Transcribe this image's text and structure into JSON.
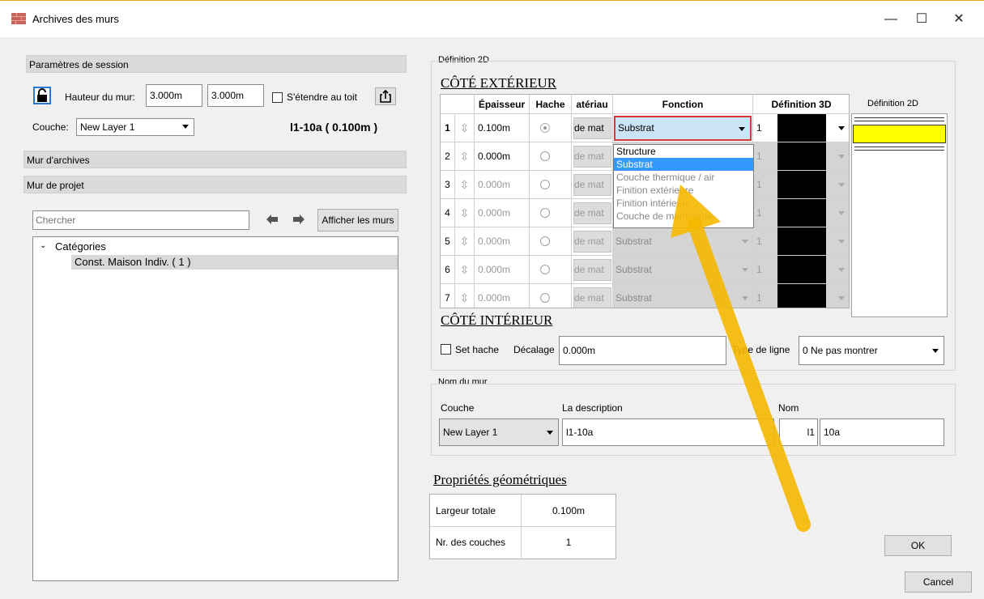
{
  "window": {
    "title": "Archives des murs",
    "minimize": "—",
    "maximize": "☐",
    "close": "✕"
  },
  "left": {
    "session_label": "Paramètres de session",
    "wall_height_label": "Hauteur du mur:",
    "wall_height_1": "3.000m",
    "wall_height_2": "3.000m",
    "extend_roof_label": "S'étendre au toit",
    "layer_label": "Couche:",
    "layer_value": "New Layer 1",
    "wall_code": "l1-10a ( 0.100m )",
    "archive_walls": "Mur d'archives",
    "project_walls": "Mur de projet",
    "search_placeholder": "Chercher",
    "show_walls_btn": "Afficher les murs",
    "tree_root": "Catégories",
    "tree_child": "Const. Maison Indiv. ( 1 )"
  },
  "def2d": {
    "group_title": "Définition 2D",
    "exterior_title": "CÔTÉ EXTÉRIEUR",
    "interior_title": "CÔTÉ INTÉRIEUR",
    "headers": {
      "thickness": "Épaisseur",
      "hatch": "Hache",
      "material": "atériau",
      "function": "Fonction",
      "def3d": "Définition 3D",
      "def2d": "Définition 2D"
    },
    "rows": [
      {
        "n": "1",
        "thickness": "0.100m",
        "mat": "de mat",
        "func": "Substrat",
        "d3": "1"
      },
      {
        "n": "2",
        "thickness": "0.000m",
        "mat": "de mat",
        "func": "",
        "d3": "1"
      },
      {
        "n": "3",
        "thickness": "0.000m",
        "mat": "de mat",
        "func": "",
        "d3": "1"
      },
      {
        "n": "4",
        "thickness": "0.000m",
        "mat": "de mat",
        "func": "",
        "d3": "1"
      },
      {
        "n": "5",
        "thickness": "0.000m",
        "mat": "de mat",
        "func": "Substrat",
        "d3": "1"
      },
      {
        "n": "6",
        "thickness": "0.000m",
        "mat": "de mat",
        "func": "Substrat",
        "d3": "1"
      },
      {
        "n": "7",
        "thickness": "0.000m",
        "mat": "de mat",
        "func": "Substrat",
        "d3": "1"
      }
    ],
    "dropdown_options": [
      "Structure",
      "Substrat",
      "Couche thermique / air",
      "Finition extérieure",
      "Finition intérieure",
      "Couche de membrane"
    ],
    "selected_option": "Substrat",
    "set_hatch_label": "Set hache",
    "offset_label": "Décalage",
    "offset_value": "0.000m",
    "line_type_label": "Type de ligne",
    "line_type_value": "0  Ne pas montrer",
    "swatch_color": "#ffff00",
    "highlight_color": "#3399ff",
    "annotation_color": "#f5b800"
  },
  "wallname": {
    "group_title": "Nom du mur",
    "layer_label": "Couche",
    "layer_value": "New Layer 1",
    "desc_label": "La description",
    "desc_value": "l1-10a",
    "name_label": "Nom",
    "name_prefix": "l1",
    "name_value": "10a"
  },
  "geo": {
    "title": "Propriétés géométriques",
    "total_width_label": "Largeur totale",
    "total_width_value": "0.100m",
    "layers_label": "Nr. des couches",
    "layers_value": "1"
  },
  "buttons": {
    "ok": "OK",
    "cancel": "Cancel"
  }
}
